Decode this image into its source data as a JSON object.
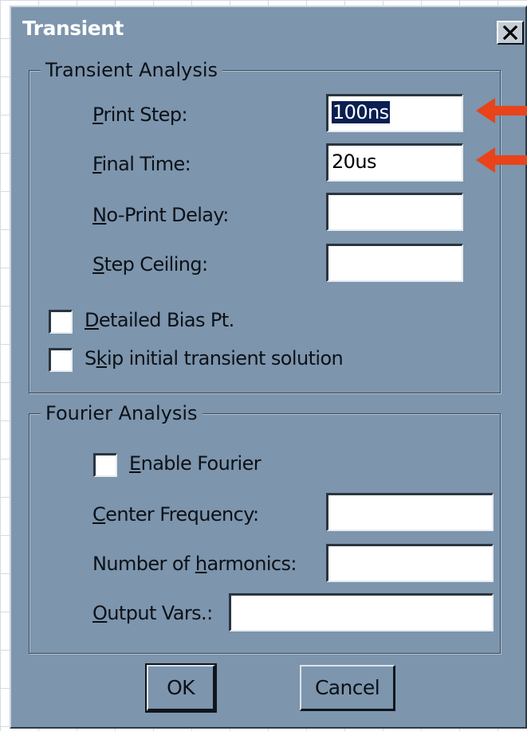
{
  "window": {
    "title": "Transient"
  },
  "transient_group": {
    "legend": "Transient Analysis",
    "print_step": {
      "label_key": "P",
      "label_rest": "rint Step:",
      "value": "100ns"
    },
    "final_time": {
      "label_key": "F",
      "label_rest": "inal Time:",
      "value": "20us"
    },
    "no_print_delay": {
      "label_key": "N",
      "label_rest": "o-Print Delay:",
      "value": ""
    },
    "step_ceiling": {
      "label_key": "S",
      "label_rest": "tep Ceiling:",
      "value": ""
    },
    "detailed_bias": {
      "label_key": "D",
      "label_rest": "etailed Bias Pt.",
      "checked": false
    },
    "skip_initial": {
      "label_pre": "S",
      "label_key": "k",
      "label_rest": "ip initial transient solution",
      "checked": false
    }
  },
  "fourier_group": {
    "legend": "Fourier Analysis",
    "enable_fourier": {
      "label_key": "E",
      "label_rest": "nable Fourier",
      "checked": false
    },
    "center_frequency": {
      "label_key": "C",
      "label_rest": "enter Frequency:",
      "value": ""
    },
    "num_harmonics": {
      "label_pre": "Number of ",
      "label_key": "h",
      "label_rest": "armonics:",
      "value": ""
    },
    "output_vars": {
      "label_key": "O",
      "label_rest": "utput Vars.:",
      "value": ""
    }
  },
  "buttons": {
    "ok": "OK",
    "cancel": "Cancel"
  },
  "colors": {
    "dialog_bg": "#7d95ad",
    "selection": "#0a1f52",
    "arrow": "#e8431a"
  },
  "icons": {
    "close": "close-icon",
    "annotation": "arrow-left-icon"
  }
}
